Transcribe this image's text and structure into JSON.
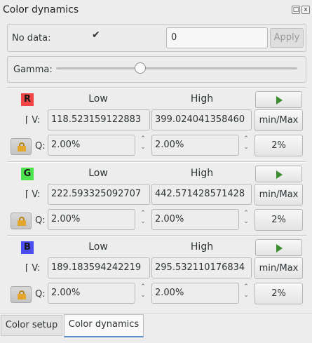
{
  "window": {
    "title": "Color dynamics",
    "float_btn": "□",
    "close_btn": "x"
  },
  "nodata": {
    "label": "No data:",
    "checked": "✔",
    "value": "0",
    "apply_label": "Apply"
  },
  "gamma": {
    "label": "Gamma:",
    "value": 0.35
  },
  "headers": {
    "low": "Low",
    "high": "High"
  },
  "labels": {
    "v": "⌈ V:",
    "q": "Q:"
  },
  "channels": [
    {
      "letter": "R",
      "color": "#f04545",
      "v_low": "118.523159122883",
      "v_high": "399.024041358460",
      "q_low": "2.00%",
      "q_high": "2.00%",
      "minmax": "min/Max",
      "pct": "2%"
    },
    {
      "letter": "G",
      "color": "#4ce34c",
      "v_low": "222.593325092707",
      "v_high": "442.571428571428",
      "q_low": "2.00%",
      "q_high": "2.00%",
      "minmax": "min/Max",
      "pct": "2%"
    },
    {
      "letter": "B",
      "color": "#4a4df0",
      "v_low": "189.183594242219",
      "v_high": "295.532110176834",
      "q_low": "2.00%",
      "q_high": "2.00%",
      "minmax": "min/Max",
      "pct": "2%"
    }
  ],
  "tabs": [
    {
      "label": "Color setup",
      "active": false
    },
    {
      "label": "Color dynamics",
      "active": true
    }
  ]
}
